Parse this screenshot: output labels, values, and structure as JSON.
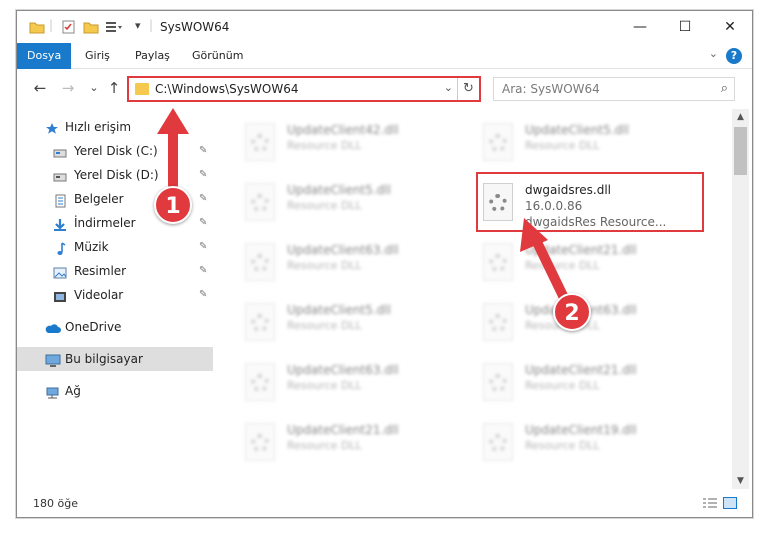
{
  "window": {
    "title": "SysWOW64",
    "minimize": "—",
    "maximize": "☐",
    "close": "✕"
  },
  "ribbon": {
    "tabs": [
      "Dosya",
      "Giriş",
      "Paylaş",
      "Görünüm"
    ],
    "help": "?",
    "collapse": "⌄"
  },
  "nav": {
    "back": "←",
    "forward": "→",
    "recent": "⌄",
    "up": "↑",
    "address": "C:\\Windows\\SysWOW64",
    "address_dropdown": "⌄",
    "refresh": "↻",
    "search_placeholder": "Ara: SysWOW64",
    "search_icon": "⌕"
  },
  "sidebar": {
    "items": [
      {
        "label": "Hızlı erişim",
        "icon": "star-icon",
        "pinned": false
      },
      {
        "label": "Yerel Disk (C:)",
        "icon": "drive-icon",
        "pinned": true
      },
      {
        "label": "Yerel Disk (D:)",
        "icon": "drive-icon",
        "pinned": true
      },
      {
        "label": "Belgeler",
        "icon": "documents-icon",
        "pinned": true
      },
      {
        "label": "İndirmeler",
        "icon": "download-icon",
        "pinned": true
      },
      {
        "label": "Müzik",
        "icon": "music-icon",
        "pinned": true
      },
      {
        "label": "Resimler",
        "icon": "pictures-icon",
        "pinned": true
      },
      {
        "label": "Videolar",
        "icon": "videos-icon",
        "pinned": true
      },
      {
        "label": "OneDrive",
        "icon": "cloud-icon",
        "pinned": false
      },
      {
        "label": "Bu bilgisayar",
        "icon": "computer-icon",
        "pinned": false
      },
      {
        "label": "Ağ",
        "icon": "network-icon",
        "pinned": false
      }
    ],
    "pin_glyph": "📌"
  },
  "files": {
    "left_column": [
      {
        "name": "UpdateClient42.dll",
        "desc": "Resource DLL"
      },
      {
        "name": "UpdateClient5.dll",
        "desc": "Resource DLL"
      },
      {
        "name": "UpdateClient63.dll",
        "desc": "Resource DLL"
      },
      {
        "name": "UpdateClient5.dll",
        "desc": "Resource DLL"
      },
      {
        "name": "UpdateClient63.dll",
        "desc": "Resource DLL"
      },
      {
        "name": "UpdateClient21.dll",
        "desc": "Resource DLL"
      }
    ],
    "right_column": [
      {
        "name": "UpdateClient5.dll",
        "desc": "Resource DLL"
      },
      {
        "name": "UpdateClient21.dll",
        "desc": "Resource DLL"
      },
      {
        "name": "UpdateClient63.dll",
        "desc": "Resource DLL"
      },
      {
        "name": "UpdateClient21.dll",
        "desc": "Resource DLL"
      },
      {
        "name": "UpdateClient19.dll",
        "desc": "Resource DLL"
      }
    ],
    "target": {
      "name": "dwgaidsres.dll",
      "version": "16.0.0.86",
      "desc": "dwgaidsRes Resource..."
    }
  },
  "status": {
    "count": "180 öğe"
  },
  "callouts": [
    "1",
    "2"
  ],
  "colors": {
    "accent": "#1979ca",
    "highlight": "#e0393e",
    "selected": "#dedede"
  }
}
